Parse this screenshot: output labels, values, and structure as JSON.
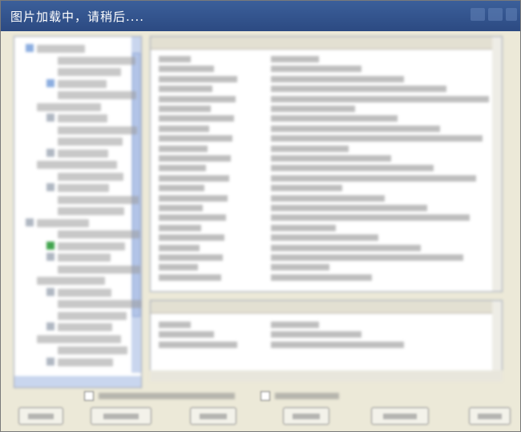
{
  "window": {
    "title": "图片加载中，请稍后...."
  },
  "colors": {
    "titlebar": "#2c4a82",
    "window_bg": "#ece9d8",
    "pane_bg": "#ffffff",
    "accent_green": "#2c9a3a"
  },
  "tree": {
    "items": [
      "",
      "",
      "",
      "",
      "",
      "",
      "",
      "",
      "",
      "",
      "",
      "",
      "",
      "",
      "",
      "",
      "",
      "",
      "",
      "",
      "",
      "",
      "",
      "",
      "",
      "",
      "",
      ""
    ]
  },
  "list_top": {
    "columns": [
      "",
      ""
    ],
    "rows": [
      [
        "",
        ""
      ],
      [
        "",
        ""
      ],
      [
        "",
        ""
      ],
      [
        "",
        ""
      ],
      [
        "",
        ""
      ],
      [
        "",
        ""
      ],
      [
        "",
        ""
      ],
      [
        "",
        ""
      ],
      [
        "",
        ""
      ],
      [
        "",
        ""
      ],
      [
        "",
        ""
      ],
      [
        "",
        ""
      ],
      [
        "",
        ""
      ],
      [
        "",
        ""
      ],
      [
        "",
        ""
      ],
      [
        "",
        ""
      ],
      [
        "",
        ""
      ],
      [
        "",
        ""
      ],
      [
        "",
        ""
      ],
      [
        "",
        ""
      ],
      [
        "",
        ""
      ],
      [
        "",
        ""
      ],
      [
        "",
        ""
      ]
    ]
  },
  "list_bottom": {
    "columns": [
      "",
      ""
    ],
    "rows": [
      [
        "",
        ""
      ],
      [
        "",
        ""
      ],
      [
        "",
        ""
      ]
    ]
  },
  "bottom_bar": {
    "checkboxes": [
      "",
      ""
    ],
    "buttons": [
      "",
      "",
      "",
      "",
      "",
      ""
    ]
  }
}
